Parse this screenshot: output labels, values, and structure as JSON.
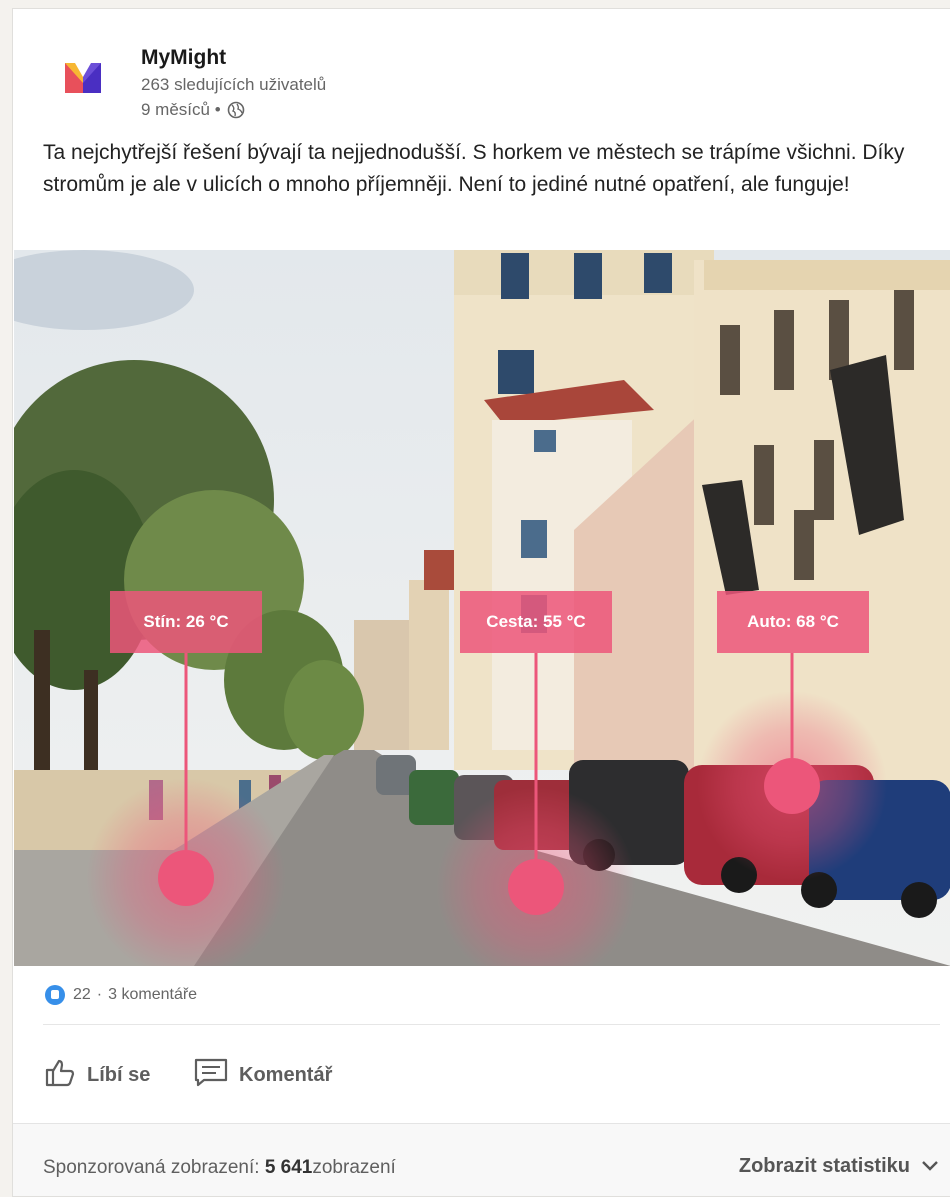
{
  "post": {
    "company": "MyMight",
    "followers": "263 sledujících uživatelů",
    "age": "9 měsíců •",
    "text": "Ta nejchytřejší řešení bývají ta nejjednodušší. S horkem ve městech se trápíme všichni. Díky stromům je ale v ulicích o mnoho příjemněji. Není to jediné nutné opatření, ale funguje!"
  },
  "image": {
    "tags": [
      {
        "label": "Stín: 26 °C"
      },
      {
        "label": "Cesta: 55 °C"
      },
      {
        "label": "Auto: 68 °C"
      }
    ]
  },
  "social": {
    "reactions": "22",
    "separator": "·",
    "comments": "3 komentáře"
  },
  "actions": {
    "like": "Líbí se",
    "comment": "Komentář"
  },
  "footer": {
    "sponsored_label": "Sponzorovaná zobrazení: ",
    "sponsored_value": "5 641",
    "sponsored_unit": "zobrazení",
    "stats_label": "Zobrazit statistiku"
  },
  "colors": {
    "accent": "#ec567a",
    "like_blue": "#378fe9"
  }
}
